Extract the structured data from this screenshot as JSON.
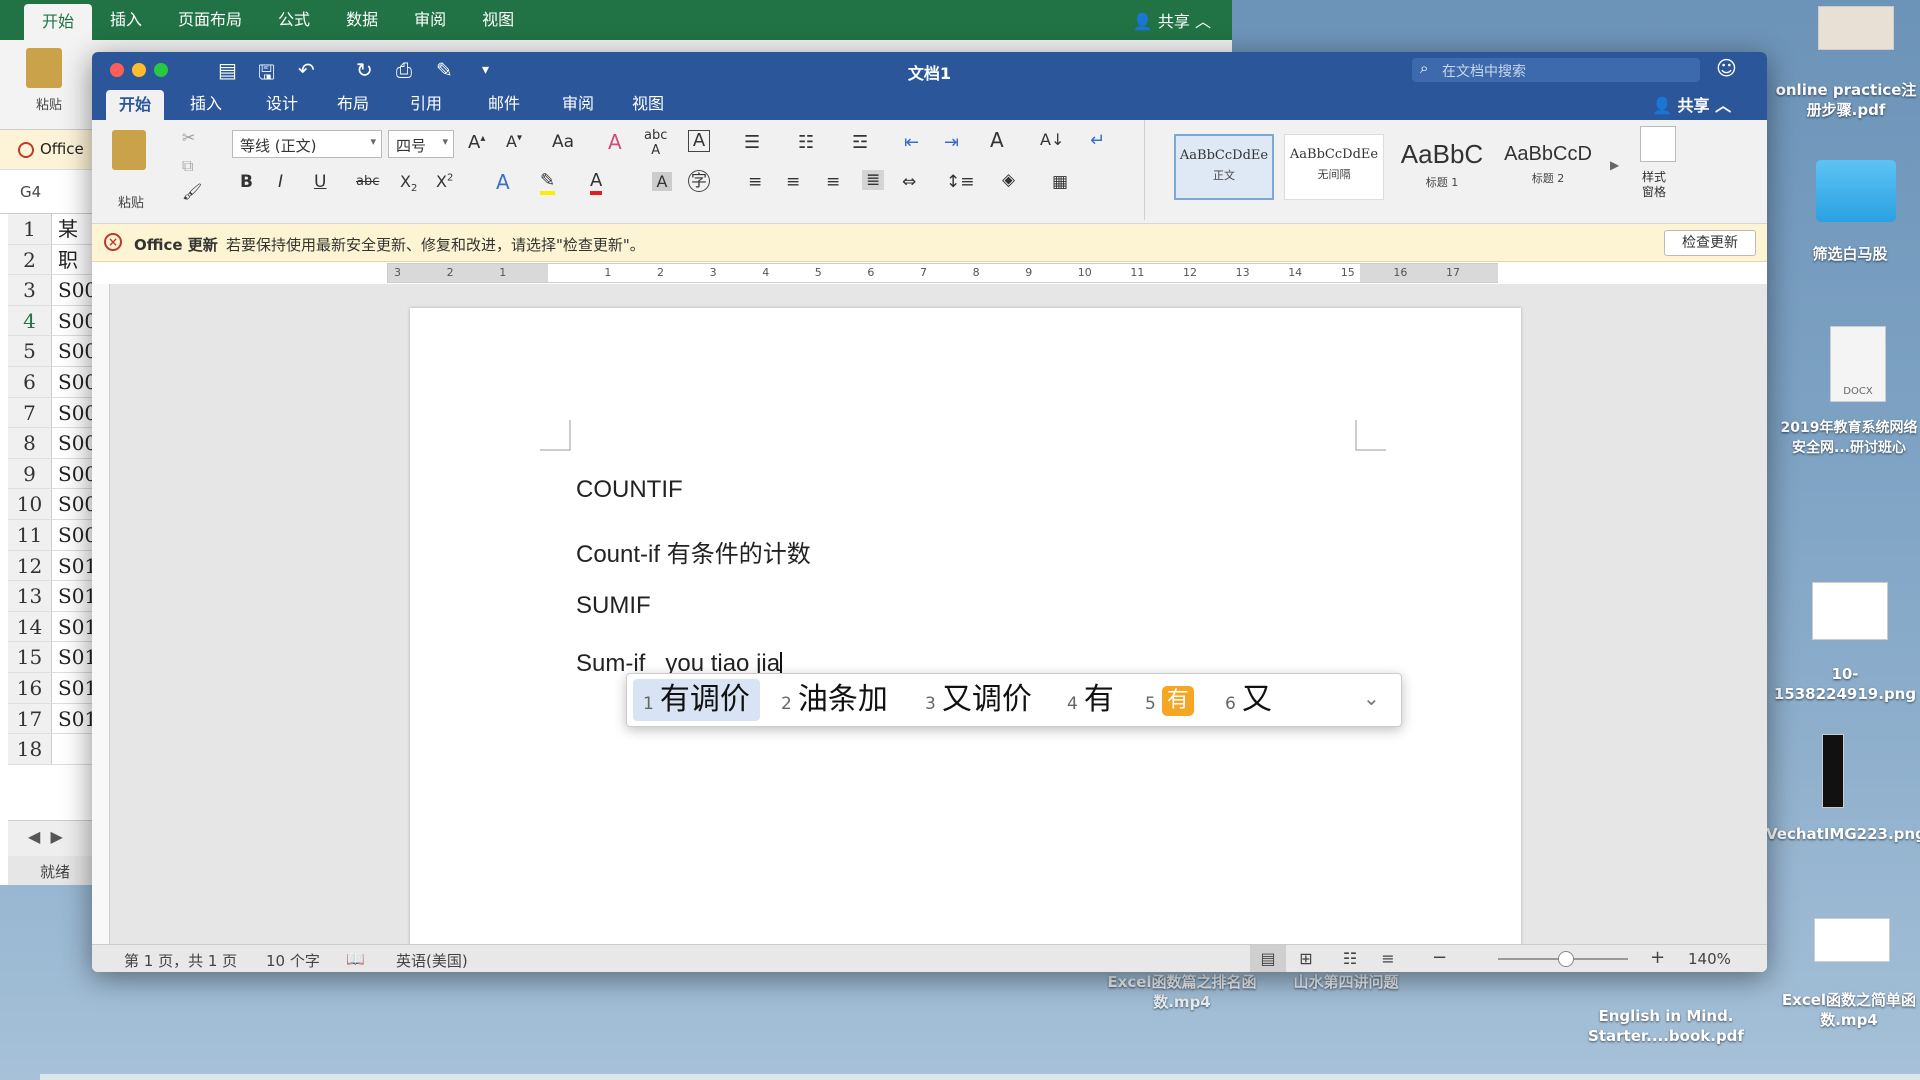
{
  "excel": {
    "tabs": [
      "开始",
      "插入",
      "页面布局",
      "公式",
      "数据",
      "审阅",
      "视图"
    ],
    "share": "共享",
    "paste": "粘贴",
    "msg": "Office",
    "namebox": "G4",
    "rows": [
      {
        "n": "1",
        "v": "某"
      },
      {
        "n": "2",
        "v": "职"
      },
      {
        "n": "3",
        "v": "S00"
      },
      {
        "n": "4",
        "v": "S00"
      },
      {
        "n": "5",
        "v": "S00"
      },
      {
        "n": "6",
        "v": "S00"
      },
      {
        "n": "7",
        "v": "S00"
      },
      {
        "n": "8",
        "v": "S00"
      },
      {
        "n": "9",
        "v": "S00"
      },
      {
        "n": "10",
        "v": "S00"
      },
      {
        "n": "11",
        "v": "S00"
      },
      {
        "n": "12",
        "v": "S01"
      },
      {
        "n": "13",
        "v": "S01"
      },
      {
        "n": "14",
        "v": "S01"
      },
      {
        "n": "15",
        "v": "S01"
      },
      {
        "n": "16",
        "v": "S01"
      },
      {
        "n": "17",
        "v": "S01"
      },
      {
        "n": "18",
        "v": ""
      }
    ],
    "status": "就绪"
  },
  "word": {
    "title": "文档1",
    "search_placeholder": "在文档中搜索",
    "tabs": [
      "开始",
      "插入",
      "设计",
      "布局",
      "引用",
      "邮件",
      "审阅",
      "视图"
    ],
    "share": "共享",
    "paste_label": "粘贴",
    "font_name": "等线 (正文)",
    "font_size": "四号",
    "styles": [
      {
        "preview": "AaBbCcDdEe",
        "name": "正文"
      },
      {
        "preview": "AaBbCcDdEe",
        "name": "无间隔"
      },
      {
        "preview": "AaBbC",
        "name": "标题 1"
      },
      {
        "preview": "AaBbCcD",
        "name": "标题 2"
      }
    ],
    "styles_pane": "样式\n窗格",
    "message": {
      "app": "Office 更新",
      "text": "若要保持使用最新安全更新、修复和改进，请选择\"检查更新\"。",
      "button": "检查更新"
    },
    "ruler_numbers": [
      "3",
      "2",
      "1",
      "",
      "1",
      "2",
      "3",
      "4",
      "5",
      "6",
      "7",
      "8",
      "9",
      "10",
      "11",
      "12",
      "13",
      "14",
      "15",
      "16",
      "17"
    ],
    "doc_lines": [
      "COUNTIF",
      "Count-if  有条件的计数",
      "SUMIF",
      "Sum-if   you tiao jia"
    ],
    "ime": {
      "candidates": [
        {
          "n": "1",
          "t": "有调价"
        },
        {
          "n": "2",
          "t": "油条加"
        },
        {
          "n": "3",
          "t": "又调价"
        },
        {
          "n": "4",
          "t": "有"
        },
        {
          "n": "5",
          "t": "有"
        },
        {
          "n": "6",
          "t": "又"
        }
      ]
    },
    "status": {
      "page": "第 1 页，共 1 页",
      "words": "10 个字",
      "language": "英语(美国)",
      "zoom": "140%",
      "zoom_minus": "−",
      "zoom_plus": "+"
    }
  },
  "desktop": {
    "icons": [
      {
        "label": "online practice注册步骤.pdf"
      },
      {
        "label": "筛选白马股"
      },
      {
        "label": "2019年教育系统网络安全网...研讨班心"
      },
      {
        "label": "10-1538224919.png"
      },
      {
        "label": "VechatIMG223.png"
      },
      {
        "label": "English in Mind. Starter....book.pdf"
      },
      {
        "label": "Excel函数之简单函数.mp4"
      },
      {
        "label": "Excel函数篇之排名函数.mp4"
      },
      {
        "label": "山水第四讲问题"
      }
    ],
    "docx_tag": "DOCX"
  }
}
